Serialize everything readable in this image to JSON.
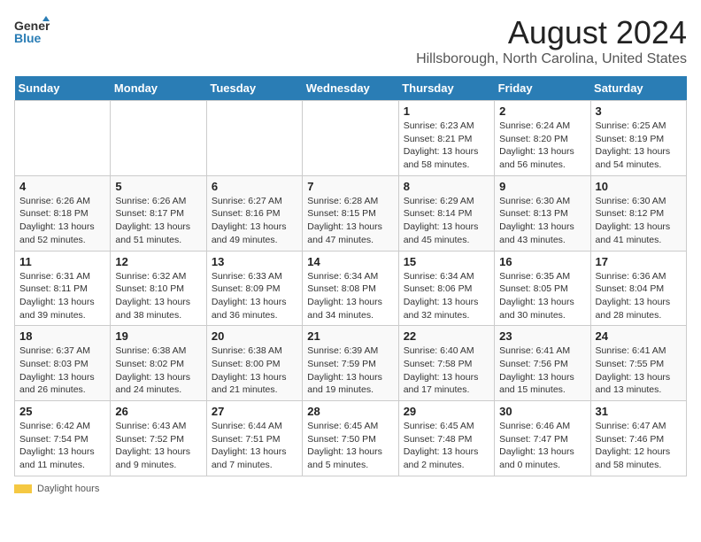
{
  "logo": {
    "general": "General",
    "blue": "Blue"
  },
  "title": "August 2024",
  "subtitle": "Hillsborough, North Carolina, United States",
  "weekdays": [
    "Sunday",
    "Monday",
    "Tuesday",
    "Wednesday",
    "Thursday",
    "Friday",
    "Saturday"
  ],
  "footer": {
    "daylight_label": "Daylight hours"
  },
  "weeks": [
    [
      {
        "day": "",
        "info": ""
      },
      {
        "day": "",
        "info": ""
      },
      {
        "day": "",
        "info": ""
      },
      {
        "day": "",
        "info": ""
      },
      {
        "day": "1",
        "info": "Sunrise: 6:23 AM\nSunset: 8:21 PM\nDaylight: 13 hours and 58 minutes."
      },
      {
        "day": "2",
        "info": "Sunrise: 6:24 AM\nSunset: 8:20 PM\nDaylight: 13 hours and 56 minutes."
      },
      {
        "day": "3",
        "info": "Sunrise: 6:25 AM\nSunset: 8:19 PM\nDaylight: 13 hours and 54 minutes."
      }
    ],
    [
      {
        "day": "4",
        "info": "Sunrise: 6:26 AM\nSunset: 8:18 PM\nDaylight: 13 hours and 52 minutes."
      },
      {
        "day": "5",
        "info": "Sunrise: 6:26 AM\nSunset: 8:17 PM\nDaylight: 13 hours and 51 minutes."
      },
      {
        "day": "6",
        "info": "Sunrise: 6:27 AM\nSunset: 8:16 PM\nDaylight: 13 hours and 49 minutes."
      },
      {
        "day": "7",
        "info": "Sunrise: 6:28 AM\nSunset: 8:15 PM\nDaylight: 13 hours and 47 minutes."
      },
      {
        "day": "8",
        "info": "Sunrise: 6:29 AM\nSunset: 8:14 PM\nDaylight: 13 hours and 45 minutes."
      },
      {
        "day": "9",
        "info": "Sunrise: 6:30 AM\nSunset: 8:13 PM\nDaylight: 13 hours and 43 minutes."
      },
      {
        "day": "10",
        "info": "Sunrise: 6:30 AM\nSunset: 8:12 PM\nDaylight: 13 hours and 41 minutes."
      }
    ],
    [
      {
        "day": "11",
        "info": "Sunrise: 6:31 AM\nSunset: 8:11 PM\nDaylight: 13 hours and 39 minutes."
      },
      {
        "day": "12",
        "info": "Sunrise: 6:32 AM\nSunset: 8:10 PM\nDaylight: 13 hours and 38 minutes."
      },
      {
        "day": "13",
        "info": "Sunrise: 6:33 AM\nSunset: 8:09 PM\nDaylight: 13 hours and 36 minutes."
      },
      {
        "day": "14",
        "info": "Sunrise: 6:34 AM\nSunset: 8:08 PM\nDaylight: 13 hours and 34 minutes."
      },
      {
        "day": "15",
        "info": "Sunrise: 6:34 AM\nSunset: 8:06 PM\nDaylight: 13 hours and 32 minutes."
      },
      {
        "day": "16",
        "info": "Sunrise: 6:35 AM\nSunset: 8:05 PM\nDaylight: 13 hours and 30 minutes."
      },
      {
        "day": "17",
        "info": "Sunrise: 6:36 AM\nSunset: 8:04 PM\nDaylight: 13 hours and 28 minutes."
      }
    ],
    [
      {
        "day": "18",
        "info": "Sunrise: 6:37 AM\nSunset: 8:03 PM\nDaylight: 13 hours and 26 minutes."
      },
      {
        "day": "19",
        "info": "Sunrise: 6:38 AM\nSunset: 8:02 PM\nDaylight: 13 hours and 24 minutes."
      },
      {
        "day": "20",
        "info": "Sunrise: 6:38 AM\nSunset: 8:00 PM\nDaylight: 13 hours and 21 minutes."
      },
      {
        "day": "21",
        "info": "Sunrise: 6:39 AM\nSunset: 7:59 PM\nDaylight: 13 hours and 19 minutes."
      },
      {
        "day": "22",
        "info": "Sunrise: 6:40 AM\nSunset: 7:58 PM\nDaylight: 13 hours and 17 minutes."
      },
      {
        "day": "23",
        "info": "Sunrise: 6:41 AM\nSunset: 7:56 PM\nDaylight: 13 hours and 15 minutes."
      },
      {
        "day": "24",
        "info": "Sunrise: 6:41 AM\nSunset: 7:55 PM\nDaylight: 13 hours and 13 minutes."
      }
    ],
    [
      {
        "day": "25",
        "info": "Sunrise: 6:42 AM\nSunset: 7:54 PM\nDaylight: 13 hours and 11 minutes."
      },
      {
        "day": "26",
        "info": "Sunrise: 6:43 AM\nSunset: 7:52 PM\nDaylight: 13 hours and 9 minutes."
      },
      {
        "day": "27",
        "info": "Sunrise: 6:44 AM\nSunset: 7:51 PM\nDaylight: 13 hours and 7 minutes."
      },
      {
        "day": "28",
        "info": "Sunrise: 6:45 AM\nSunset: 7:50 PM\nDaylight: 13 hours and 5 minutes."
      },
      {
        "day": "29",
        "info": "Sunrise: 6:45 AM\nSunset: 7:48 PM\nDaylight: 13 hours and 2 minutes."
      },
      {
        "day": "30",
        "info": "Sunrise: 6:46 AM\nSunset: 7:47 PM\nDaylight: 13 hours and 0 minutes."
      },
      {
        "day": "31",
        "info": "Sunrise: 6:47 AM\nSunset: 7:46 PM\nDaylight: 12 hours and 58 minutes."
      }
    ]
  ]
}
